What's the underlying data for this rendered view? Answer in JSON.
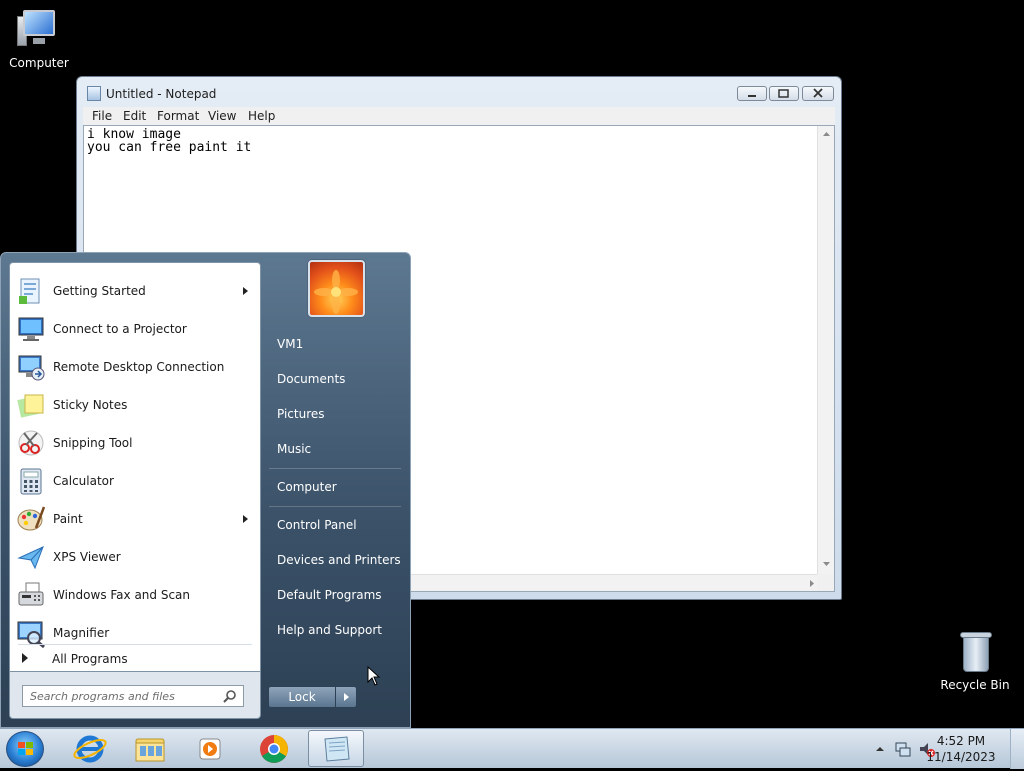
{
  "desktop": {
    "icons": [
      {
        "label": "Computer"
      },
      {
        "label": "Recycle Bin"
      }
    ]
  },
  "notepad": {
    "title": "Untitled - Notepad",
    "menu": [
      "File",
      "Edit",
      "Format",
      "View",
      "Help"
    ],
    "text_lines": [
      "i know image",
      "you can free paint it"
    ]
  },
  "start_menu": {
    "programs": [
      {
        "label": "Getting Started",
        "icon": "getting-started-icon",
        "submenu": true
      },
      {
        "label": "Connect to a Projector",
        "icon": "projector-icon",
        "submenu": false
      },
      {
        "label": "Remote Desktop Connection",
        "icon": "remote-desktop-icon",
        "submenu": false
      },
      {
        "label": "Sticky Notes",
        "icon": "sticky-notes-icon",
        "submenu": false
      },
      {
        "label": "Snipping Tool",
        "icon": "scissors-icon",
        "submenu": false
      },
      {
        "label": "Calculator",
        "icon": "calculator-icon",
        "submenu": false
      },
      {
        "label": "Paint",
        "icon": "palette-icon",
        "submenu": true
      },
      {
        "label": "XPS Viewer",
        "icon": "paper-plane-icon",
        "submenu": false
      },
      {
        "label": "Windows Fax and Scan",
        "icon": "fax-icon",
        "submenu": false
      },
      {
        "label": "Magnifier",
        "icon": "magnifier-icon",
        "submenu": false
      }
    ],
    "all_programs": "All Programs",
    "search_placeholder": "Search programs and files",
    "right_items": [
      {
        "label": "VM1"
      },
      {
        "label": "Documents"
      },
      {
        "label": "Pictures"
      },
      {
        "label": "Music"
      },
      {
        "label": "Computer"
      },
      {
        "label": "Control Panel"
      },
      {
        "label": "Devices and Printers"
      },
      {
        "label": "Default Programs"
      },
      {
        "label": "Help and Support"
      }
    ],
    "lock_label": "Lock"
  },
  "taskbar": {
    "pinned": [
      "internet-explorer-icon",
      "file-explorer-icon",
      "media-player-icon",
      "chrome-icon",
      "notepad-icon"
    ],
    "clock_time": "4:52 PM",
    "clock_date": "11/14/2023"
  },
  "colors": {
    "start_menu_right": "#3b5269",
    "taskbar": "#c7d6e6",
    "desktop": "#000000"
  }
}
